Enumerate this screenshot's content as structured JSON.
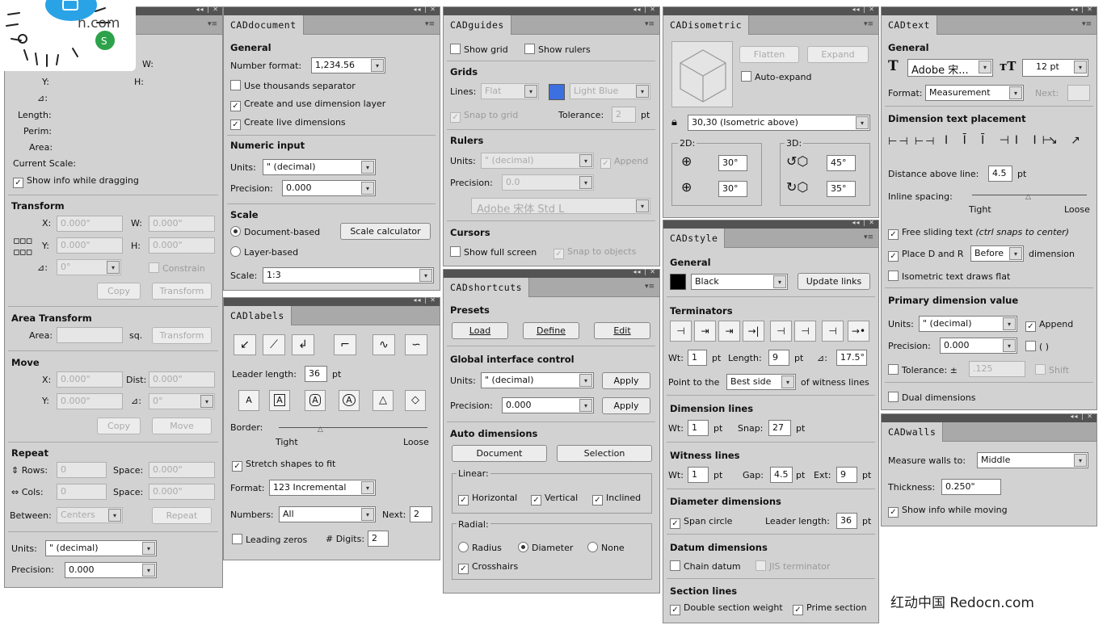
{
  "logo": {
    "url_fragment": "n.com"
  },
  "watermark": "红动中国 Redocn.com",
  "info": {
    "labels": {
      "w": "W:",
      "y": "Y:",
      "h": "H:",
      "angle": "⊿:",
      "length": "Length:",
      "perim": "Perim:",
      "area": "Area:",
      "current_scale": "Current Scale:"
    },
    "show_info": "Show info while dragging",
    "transform": {
      "title": "Transform",
      "x": "X:",
      "x_val": "0.000\"",
      "w": "W:",
      "w_val": "0.000\"",
      "y": "Y:",
      "y_val": "0.000\"",
      "h": "H:",
      "h_val": "0.000\"",
      "angle": "⊿:",
      "angle_val": "0°",
      "constrain": "Constrain",
      "copy": "Copy",
      "transform": "Transform"
    },
    "area_transform": {
      "title": "Area Transform",
      "area": "Area:",
      "sq": "sq.",
      "transform": "Transform"
    },
    "move": {
      "title": "Move",
      "x": "X:",
      "x_val": "0.000\"",
      "dist": "Dist:",
      "dist_val": "0.000\"",
      "y": "Y:",
      "y_val": "0.000\"",
      "angle": "⊿:",
      "angle_val": "0°",
      "copy": "Copy",
      "move": "Move"
    },
    "repeat": {
      "title": "Repeat",
      "rows": "⇕ Rows:",
      "rows_val": "0",
      "cols": "⇔ Cols:",
      "cols_val": "0",
      "space": "Space:",
      "space_val": "0.000\"",
      "between": "Between:",
      "between_val": "Centers",
      "repeat": "Repeat"
    },
    "units": "Units:",
    "units_val": "\" (decimal)",
    "precision": "Precision:",
    "precision_val": "0.000"
  },
  "document": {
    "tab": "CADdocument",
    "general": "General",
    "number_format": "Number format:",
    "number_format_val": "1,234.56",
    "thousands": "Use thousands separator",
    "dim_layer": "Create and use dimension layer",
    "live_dims": "Create live dimensions",
    "numeric_input": "Numeric input",
    "units": "Units:",
    "units_val": "\" (decimal)",
    "precision": "Precision:",
    "precision_val": "0.000",
    "scale": "Scale",
    "doc_based": "Document-based",
    "scale_calc": "Scale calculator",
    "layer_based": "Layer-based",
    "scale_lbl": "Scale:",
    "scale_val": "1:3"
  },
  "labels": {
    "tab": "CADlabels",
    "leader_length": "Leader length:",
    "leader_val": "36",
    "pt": "pt",
    "border": "Border:",
    "tight": "Tight",
    "loose": "Loose",
    "stretch": "Stretch shapes to fit",
    "format": "Format:",
    "format_val": "123 Incremental",
    "numbers": "Numbers:",
    "numbers_val": "All",
    "next": "Next:",
    "next_val": "2",
    "leading_zeros": "Leading zeros",
    "digits": "# Digits:",
    "digits_val": "2",
    "shapes": [
      "A",
      "A",
      "A",
      "A",
      "A",
      "A"
    ]
  },
  "guides": {
    "tab": "CADguides",
    "show_grid": "Show grid",
    "show_rulers": "Show rulers",
    "grids": "Grids",
    "lines": "Lines:",
    "lines_val": "Flat",
    "color_val": "Light Blue",
    "color_hex": "#3c6fe0",
    "snap_grid": "Snap to grid",
    "tolerance": "Tolerance:",
    "tolerance_val": "2",
    "pt": "pt",
    "rulers": "Rulers",
    "units": "Units:",
    "units_val": "\" (decimal)",
    "append": "Append",
    "precision": "Precision:",
    "precision_val": "0.0",
    "font_val": "Adobe 宋体 Std L",
    "cursors": "Cursors",
    "full_screen": "Show full screen",
    "snap_objects": "Snap to objects"
  },
  "shortcuts": {
    "tab": "CADshortcuts",
    "presets": "Presets",
    "load": "Load",
    "define": "Define",
    "edit": "Edit",
    "global": "Global interface control",
    "units": "Units:",
    "units_val": "\" (decimal)",
    "apply": "Apply",
    "precision": "Precision:",
    "precision_val": "0.000",
    "auto_dims": "Auto dimensions",
    "document": "Document",
    "selection": "Selection",
    "linear": "Linear:",
    "horizontal": "Horizontal",
    "vertical": "Vertical",
    "inclined": "Inclined",
    "radial": "Radial:",
    "radius": "Radius",
    "diameter": "Diameter",
    "none": "None",
    "crosshairs": "Crosshairs"
  },
  "isometric": {
    "tab": "CADisometric",
    "flatten": "Flatten",
    "expand": "Expand",
    "auto_expand": "Auto-expand",
    "preset_val": "30,30 (Isometric above)",
    "two_d": "2D:",
    "three_d": "3D:",
    "v2a": "30°",
    "v2b": "30°",
    "v3a": "45°",
    "v3b": "35°"
  },
  "style": {
    "tab": "CADstyle",
    "general": "General",
    "color_val": "Black",
    "update_links": "Update links",
    "terminators": "Terminators",
    "wt": "Wt:",
    "wt_val": "1",
    "pt": "pt",
    "length": "Length:",
    "length_val": "9",
    "angle": "⊿:",
    "angle_val": "17.5°",
    "point_to": "Point to the",
    "point_val": "Best side",
    "of_witness": "of witness lines",
    "dim_lines": "Dimension lines",
    "snap": "Snap:",
    "snap_val": "27",
    "witness": "Witness lines",
    "gap": "Gap:",
    "gap_val": "4.5",
    "ext": "Ext:",
    "ext_val": "9",
    "diameter_dims": "Diameter dimensions",
    "span_circle": "Span circle",
    "leader_length": "Leader length:",
    "leader_val": "36",
    "datum_dims": "Datum dimensions",
    "chain_datum": "Chain datum",
    "jis": "JIS terminator",
    "section_lines": "Section lines",
    "double_section": "Double section weight",
    "prime_section": "Prime section"
  },
  "text": {
    "tab": "CADtext",
    "general": "General",
    "font_val": "Adobe 宋...",
    "size_val": "12 pt",
    "format": "Format:",
    "format_val": "Measurement",
    "next": "Next:",
    "placement": "Dimension text placement",
    "distance": "Distance above line:",
    "distance_val": "4.5",
    "pt": "pt",
    "inline": "Inline spacing:",
    "tight": "Tight",
    "loose": "Loose",
    "free_sliding": "Free sliding text",
    "free_hint": "(ctrl snaps to center)",
    "place_dr": "Place D and R",
    "place_val": "Before",
    "dimension": "dimension",
    "iso_flat": "Isometric text draws flat",
    "primary": "Primary dimension value",
    "units": "Units:",
    "units_val": "\" (decimal)",
    "append": "Append",
    "precision": "Precision:",
    "precision_val": "0.000",
    "parens": "( )",
    "tolerance": "Tolerance: ±",
    "tolerance_val": ".125",
    "shift": "Shift",
    "dual": "Dual dimensions"
  },
  "walls": {
    "tab": "CADwalls",
    "measure": "Measure walls to:",
    "measure_val": "Middle",
    "thickness": "Thickness:",
    "thickness_val": "0.250\"",
    "show_info": "Show info while moving"
  }
}
